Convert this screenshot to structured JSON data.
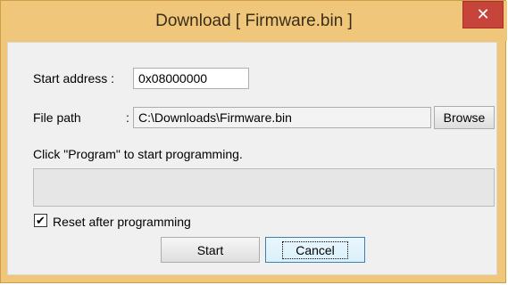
{
  "window": {
    "title": "Download [ Firmware.bin ]",
    "close_glyph": "✕"
  },
  "form": {
    "start_address_label": "Start address :",
    "start_address_value": "0x08000000",
    "file_path_label": "File path",
    "file_path_colon": ":",
    "file_path_value": "C:\\Downloads\\Firmware.bin",
    "browse_label": "Browse",
    "status_text": "Click \"Program\" to start programming.",
    "progress_fraction": 0,
    "reset_checkbox_checked": true,
    "reset_checkbox_glyph": "✔",
    "reset_label": "Reset after programming"
  },
  "buttons": {
    "start_label": "Start",
    "cancel_label": "Cancel"
  },
  "colors": {
    "title_bar": "#f0c77a",
    "close_button": "#c7443b",
    "dialog_background": "#f0f0f0"
  }
}
